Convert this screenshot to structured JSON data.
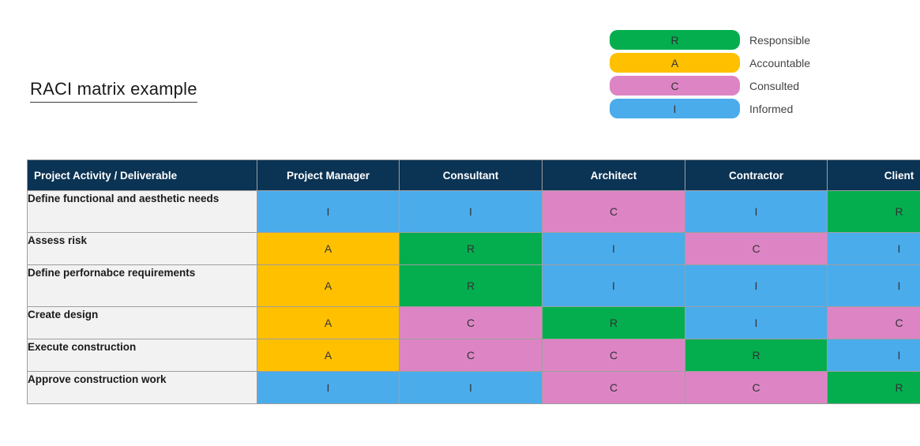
{
  "title": "RACI matrix example",
  "colors": {
    "responsible": "#04ae4f",
    "accountable": "#ffc000",
    "consulted": "#dd85c4",
    "informed": "#4bacec",
    "header_bg": "#0b3354",
    "activity_bg": "#f2f2f2",
    "border": "#9e9e9e"
  },
  "legend": {
    "items": [
      {
        "code": "R",
        "label": "Responsible",
        "color": "#04ae4f"
      },
      {
        "code": "A",
        "label": "Accountable",
        "color": "#ffc000"
      },
      {
        "code": "C",
        "label": "Consulted",
        "color": "#dd85c4"
      },
      {
        "code": "I",
        "label": "Informed",
        "color": "#4bacec"
      }
    ]
  },
  "table": {
    "columns": [
      "Project Activity / Deliverable",
      "Project Manager",
      "Consultant",
      "Architect",
      "Contractor",
      "Client"
    ],
    "rows": [
      {
        "activity": "Define functional and aesthetic needs",
        "cells": [
          "I",
          "I",
          "C",
          "I",
          "R"
        ]
      },
      {
        "activity": "Assess risk",
        "cells": [
          "A",
          "R",
          "I",
          "C",
          "I"
        ]
      },
      {
        "activity": "Define perfornabce requirements",
        "cells": [
          "A",
          "R",
          "I",
          "I",
          "I"
        ]
      },
      {
        "activity": "Create design",
        "cells": [
          "A",
          "C",
          "R",
          "I",
          "C"
        ]
      },
      {
        "activity": "Execute construction",
        "cells": [
          "A",
          "C",
          "C",
          "R",
          "I"
        ]
      },
      {
        "activity": "Approve construction work",
        "cells": [
          "I",
          "I",
          "C",
          "C",
          "R"
        ]
      }
    ]
  }
}
